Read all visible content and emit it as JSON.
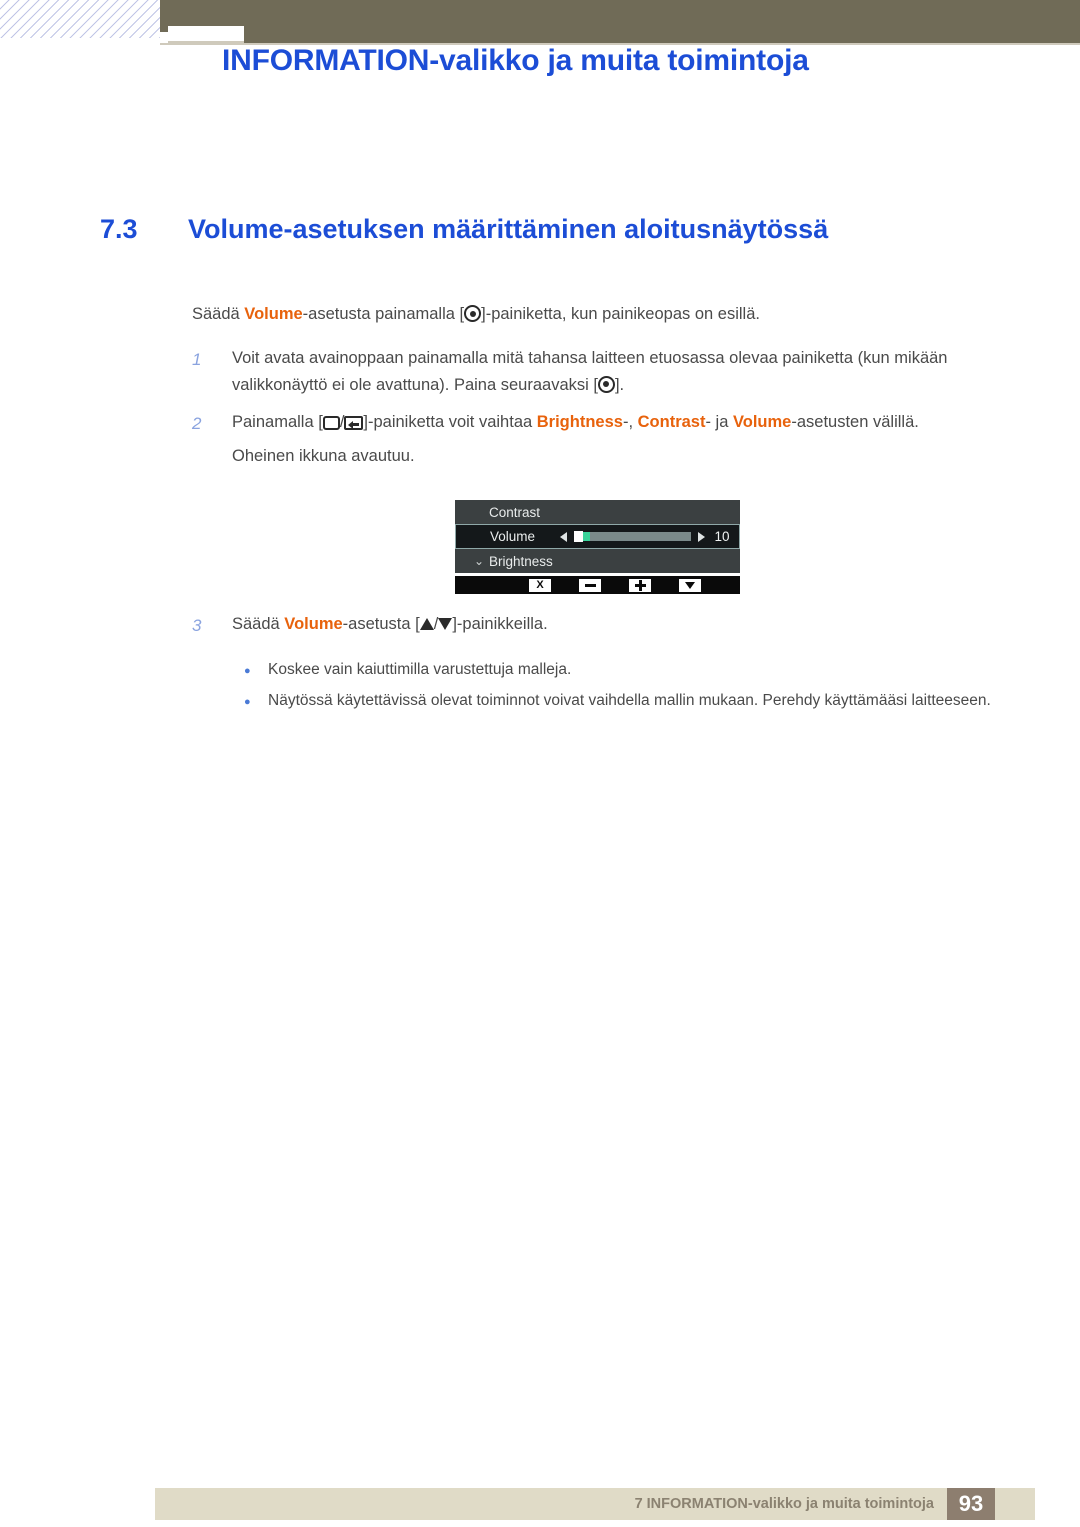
{
  "header": {
    "title": "INFORMATION-valikko ja muita toimintoja"
  },
  "section": {
    "number": "7.3",
    "title": "Volume-asetuksen määrittäminen aloitusnäytössä"
  },
  "lead": {
    "part1": "Säädä ",
    "keyword": "Volume",
    "part2": "-asetusta painamalla [",
    "part3": "]-painiketta, kun painikeopas on esillä."
  },
  "steps": [
    {
      "number": "1",
      "text_a": "Voit avata avainoppaan painamalla mitä tahansa laitteen etuosassa olevaa painiketta (kun mikään valikkonäyttö ei ole avattuna). Paina seuraavaksi [",
      "text_b": "]."
    },
    {
      "number": "2",
      "text_a": "Painamalla [",
      "sep": "/",
      "text_b": "]-painiketta voit vaihtaa ",
      "kw1": "Brightness",
      "text_c": "-, ",
      "kw2": "Contrast",
      "text_d": "- ja ",
      "kw3": "Volume",
      "text_e": "-asetusten välillä.",
      "text_f": "Oheinen ikkuna avautuu."
    },
    {
      "number": "3",
      "text_a": "Säädä ",
      "kw1": "Volume",
      "text_b": "-asetusta [",
      "sep": "/",
      "text_c": "]-painikkeilla."
    }
  ],
  "osd": {
    "rows": [
      {
        "label": "Contrast",
        "chevron": "",
        "type": "plain"
      },
      {
        "label": "Volume",
        "chevron": "",
        "type": "slider",
        "value": "10"
      },
      {
        "label": "Brightness",
        "chevron": "⌄",
        "type": "plain"
      }
    ],
    "buttons": [
      {
        "name": "close-button",
        "glyph": "X"
      },
      {
        "name": "minus-button",
        "glyph": "−"
      },
      {
        "name": "plus-button",
        "glyph": "+"
      },
      {
        "name": "down-button",
        "glyph": "▼"
      }
    ],
    "accent_color": "#3ad49a",
    "panel_color": "#3b4041",
    "active_row_color": "#14181a"
  },
  "bullets": [
    "Koskee vain kaiuttimilla varustettuja malleja.",
    "Näytössä käytettävissä olevat toiminnot voivat vaihdella mallin mukaan. Perehdy käyttämääsi laitteeseen."
  ],
  "footer": {
    "text": "7 INFORMATION-valikko ja muita toimintoja",
    "page": "93"
  }
}
